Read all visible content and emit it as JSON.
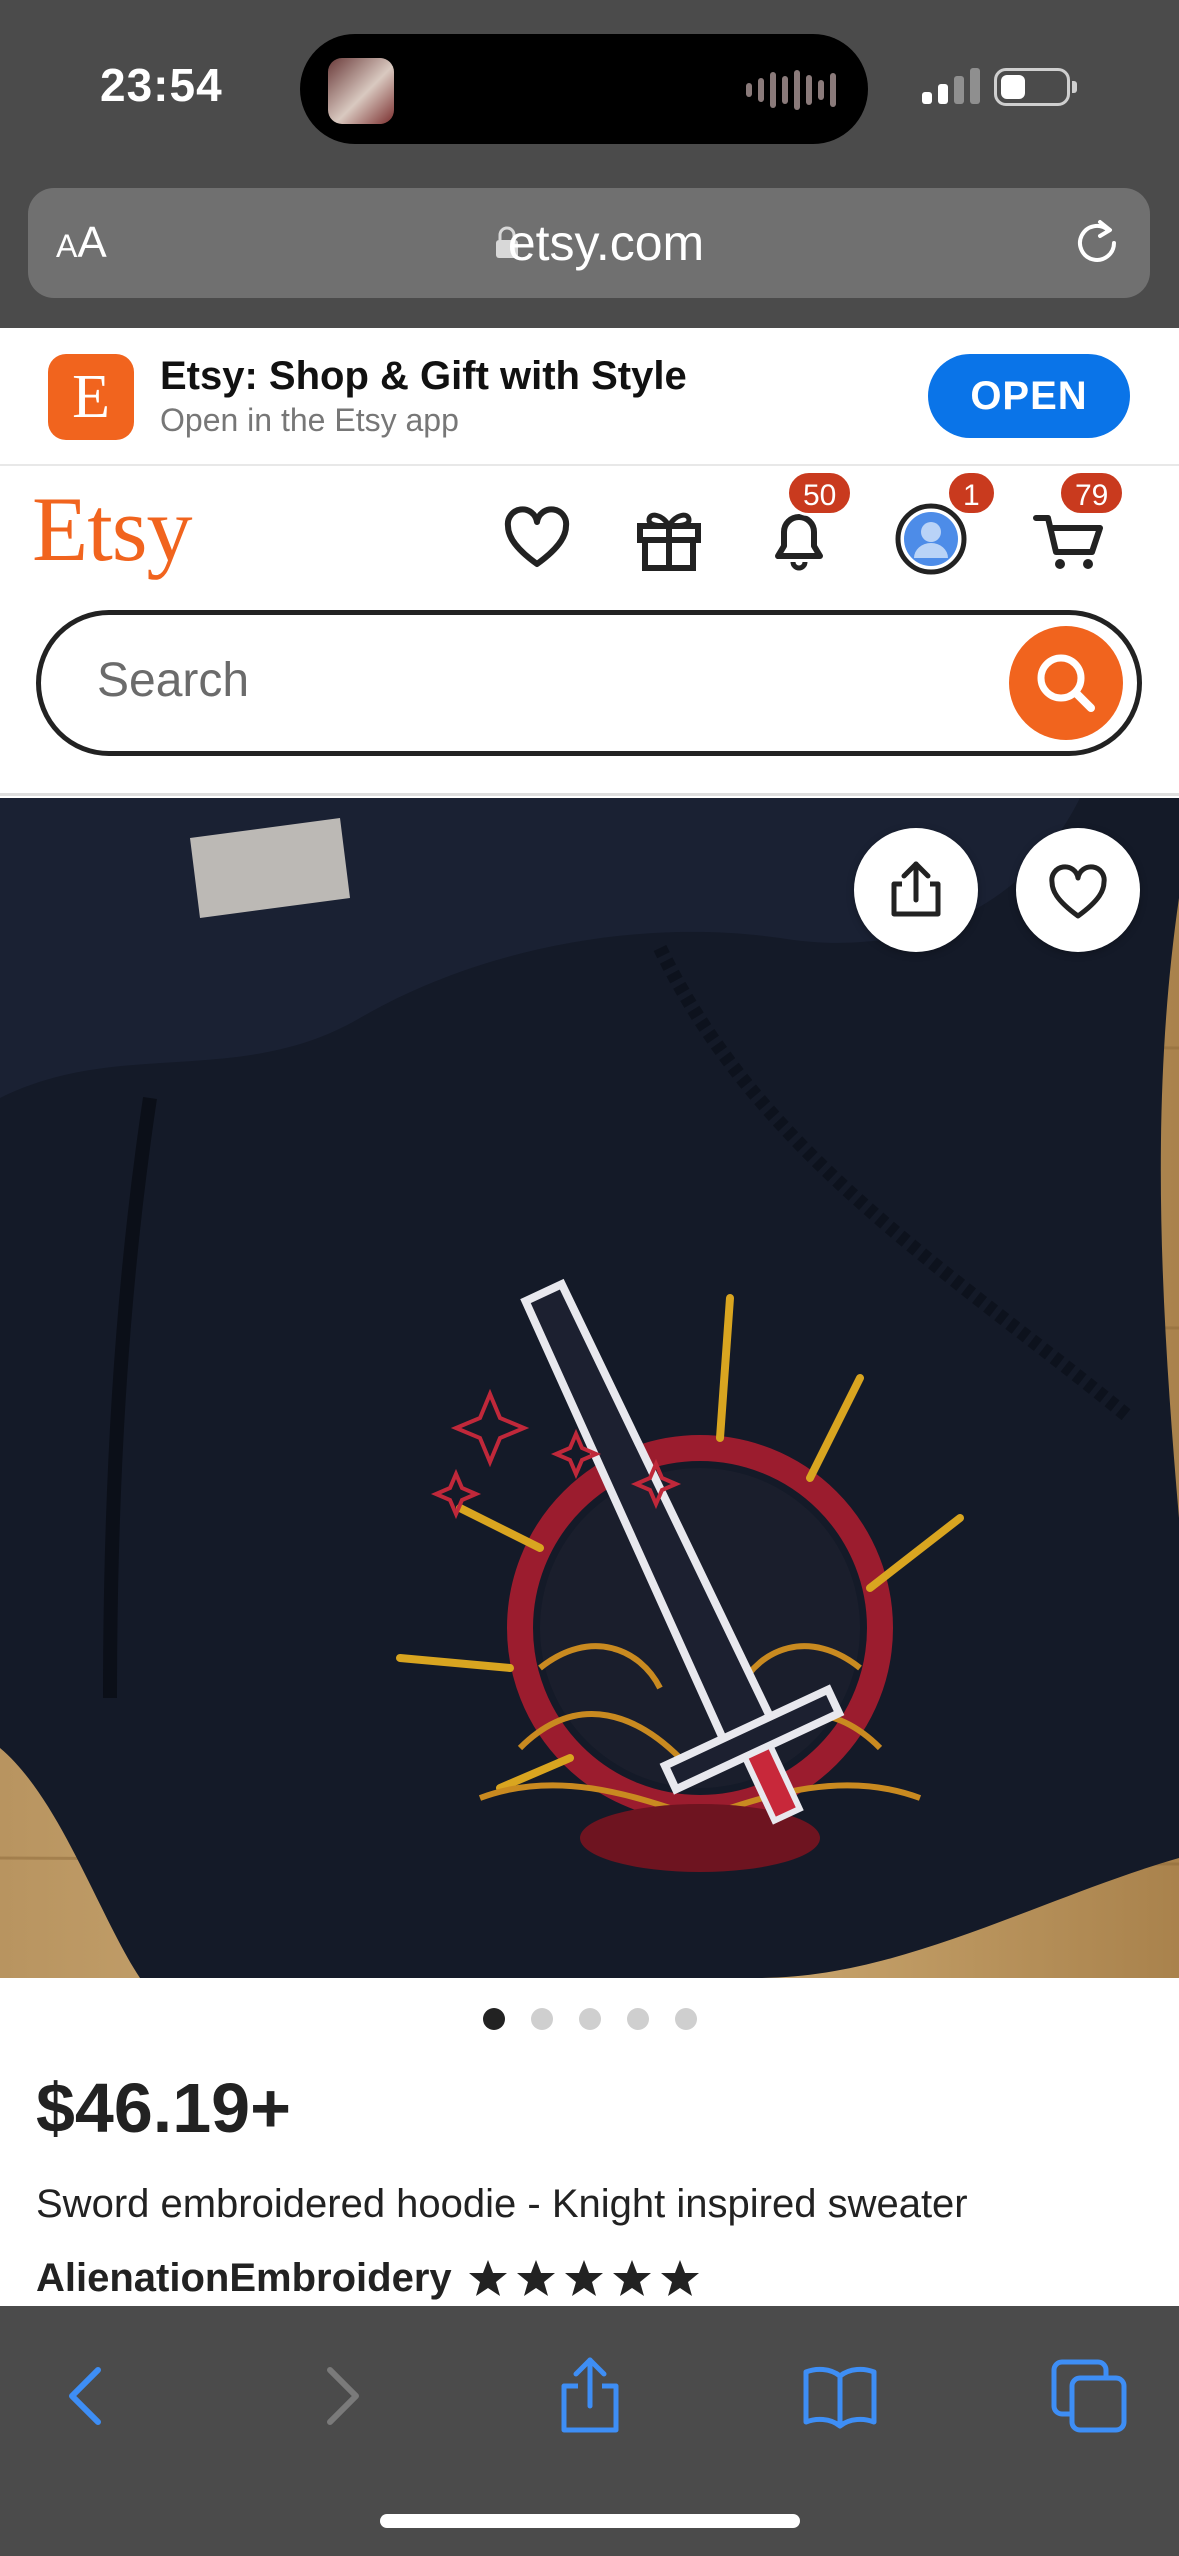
{
  "status_bar": {
    "time": "23:54"
  },
  "safari": {
    "text_size_label": "AA",
    "url": "etsy.com"
  },
  "app_banner": {
    "logo_letter": "E",
    "title": "Etsy: Shop & Gift with Style",
    "subtitle": "Open in the Etsy app",
    "open_label": "OPEN"
  },
  "header": {
    "logo": "Etsy",
    "icons": [
      "heart-icon",
      "gift-icon",
      "bell-icon",
      "avatar",
      "cart-icon"
    ],
    "notifications_count": "50",
    "account_count": "1",
    "cart_count": "79",
    "accent_color": "#f1641e"
  },
  "search": {
    "placeholder": "Search"
  },
  "product": {
    "image_count": 5,
    "active_image": 1,
    "price": "$46.19+",
    "title": "Sword embroidered hoodie - Knight inspired sweater",
    "shop": "AlienationEmbroidery",
    "rating_stars": 5
  },
  "toolbar": {
    "icons": [
      "back-icon",
      "forward-icon",
      "share-icon",
      "bookmarks-icon",
      "tabs-icon"
    ]
  }
}
